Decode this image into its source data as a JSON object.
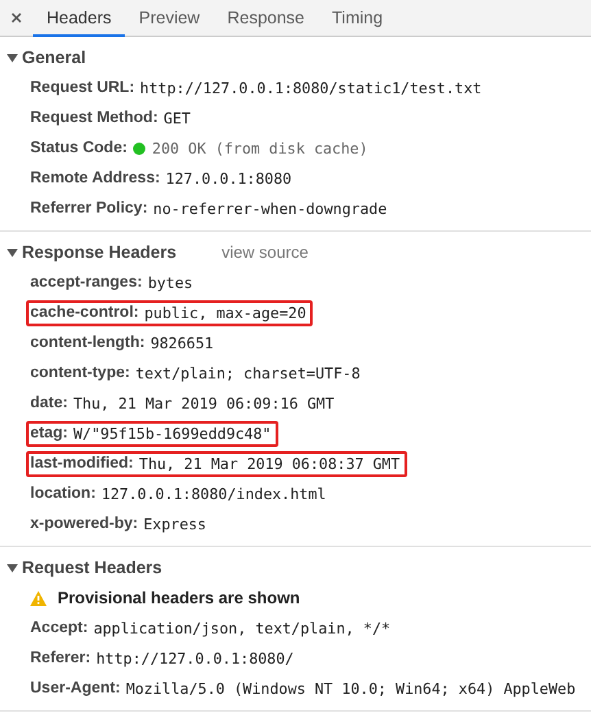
{
  "tabs": [
    {
      "label": "Headers",
      "selected": true
    },
    {
      "label": "Preview",
      "selected": false
    },
    {
      "label": "Response",
      "selected": false
    },
    {
      "label": "Timing",
      "selected": false
    }
  ],
  "sections": [
    {
      "title": "General",
      "expanded": true,
      "rows": [
        {
          "kind": "header",
          "name": "Request URL:",
          "value": "http://127.0.0.1:8080/static1/test.txt",
          "highlighted": false
        },
        {
          "kind": "header",
          "name": "Request Method:",
          "value": "GET",
          "highlighted": false
        },
        {
          "kind": "status",
          "name": "Status Code:",
          "value": "200 OK (from disk cache)",
          "highlighted": false
        },
        {
          "kind": "header",
          "name": "Remote Address:",
          "value": "127.0.0.1:8080",
          "highlighted": false
        },
        {
          "kind": "header",
          "name": "Referrer Policy:",
          "value": "no-referrer-when-downgrade",
          "highlighted": false
        }
      ]
    },
    {
      "title": "Response Headers",
      "expanded": true,
      "link": "view source",
      "rows": [
        {
          "kind": "header",
          "name": "accept-ranges:",
          "value": "bytes",
          "highlighted": false
        },
        {
          "kind": "header",
          "name": "cache-control:",
          "value": "public, max-age=20",
          "highlighted": true
        },
        {
          "kind": "header",
          "name": "content-length:",
          "value": "9826651",
          "highlighted": false
        },
        {
          "kind": "header",
          "name": "content-type:",
          "value": "text/plain; charset=UTF-8",
          "highlighted": false
        },
        {
          "kind": "header",
          "name": "date:",
          "value": "Thu, 21 Mar 2019 06:09:16 GMT",
          "highlighted": false
        },
        {
          "kind": "header",
          "name": "etag:",
          "value": "W/\"95f15b-1699edd9c48\"",
          "highlighted": true
        },
        {
          "kind": "header",
          "name": "last-modified:",
          "value": "Thu, 21 Mar 2019 06:08:37 GMT",
          "highlighted": true
        },
        {
          "kind": "header",
          "name": "location:",
          "value": "127.0.0.1:8080/index.html",
          "highlighted": false
        },
        {
          "kind": "header",
          "name": "x-powered-by:",
          "value": "Express",
          "highlighted": false
        }
      ]
    },
    {
      "title": "Request Headers",
      "expanded": true,
      "rows": [
        {
          "kind": "warning",
          "value": "Provisional headers are shown",
          "highlighted": false
        },
        {
          "kind": "header",
          "name": "Accept:",
          "value": "application/json, text/plain, */*",
          "highlighted": false
        },
        {
          "kind": "header",
          "name": "Referer:",
          "value": "http://127.0.0.1:8080/",
          "highlighted": false
        },
        {
          "kind": "header",
          "name": "User-Agent:",
          "value": "Mozilla/5.0 (Windows NT 10.0; Win64; x64) AppleWeb",
          "highlighted": false
        }
      ]
    }
  ]
}
